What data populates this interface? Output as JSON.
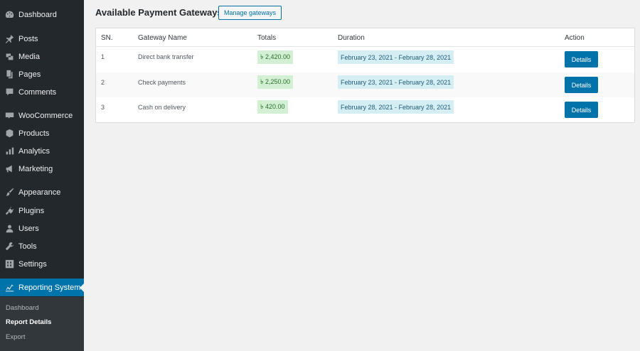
{
  "sidebar": {
    "items": [
      {
        "label": "Dashboard",
        "icon": "dashboard-icon"
      },
      {
        "label": "Posts",
        "icon": "pin-icon"
      },
      {
        "label": "Media",
        "icon": "media-icon"
      },
      {
        "label": "Pages",
        "icon": "pages-icon"
      },
      {
        "label": "Comments",
        "icon": "comment-icon"
      },
      {
        "label": "WooCommerce",
        "icon": "woocommerce-icon"
      },
      {
        "label": "Products",
        "icon": "box-icon"
      },
      {
        "label": "Analytics",
        "icon": "bar-chart-icon"
      },
      {
        "label": "Marketing",
        "icon": "megaphone-icon"
      },
      {
        "label": "Appearance",
        "icon": "brush-icon"
      },
      {
        "label": "Plugins",
        "icon": "plug-icon"
      },
      {
        "label": "Users",
        "icon": "user-icon"
      },
      {
        "label": "Tools",
        "icon": "wrench-icon"
      },
      {
        "label": "Settings",
        "icon": "settings-icon"
      },
      {
        "label": "Reporting System",
        "icon": "line-chart-icon"
      }
    ],
    "submenu": [
      {
        "label": "Dashboard"
      },
      {
        "label": "Report Details"
      },
      {
        "label": "Export"
      }
    ]
  },
  "main": {
    "title": "Available Payment Gateways",
    "manage_button": "Manage gateways"
  },
  "table": {
    "headers": {
      "sn": "SN.",
      "gateway": "Gateway Name",
      "totals": "Totals",
      "duration": "Duration",
      "action": "Action"
    },
    "rows": [
      {
        "sn": "1",
        "gateway": "Direct bank transfer",
        "total": "৳ 2,420.00",
        "duration": "February 23, 2021 - February 28, 2021",
        "action": "Details"
      },
      {
        "sn": "2",
        "gateway": "Check payments",
        "total": "৳ 2,250.00",
        "duration": "February 23, 2021 - February 28, 2021",
        "action": "Details"
      },
      {
        "sn": "3",
        "gateway": "Cash on delivery",
        "total": "৳ 420.00",
        "duration": "February 28, 2021 - February 28, 2021",
        "action": "Details"
      }
    ]
  },
  "colors": {
    "sidebar_bg": "#23282d",
    "active_bg": "#0073aa",
    "total_badge_bg": "#d4f0d4",
    "duration_badge_bg": "#d5eef4",
    "button_bg": "#0073aa"
  }
}
